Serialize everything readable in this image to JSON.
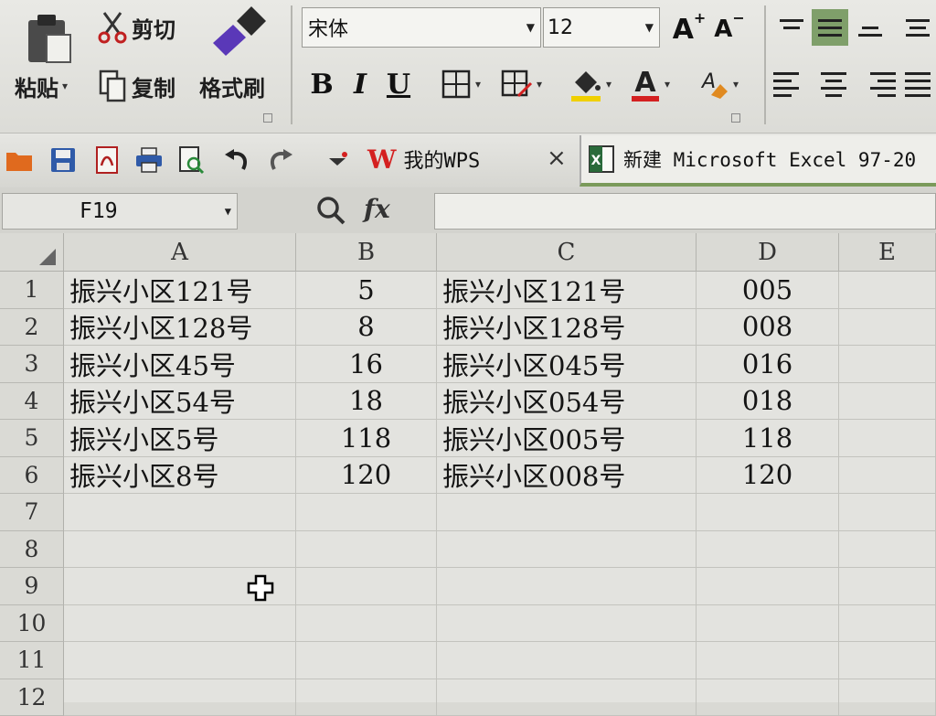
{
  "ribbon": {
    "paste": "粘贴",
    "cut": "剪切",
    "copy": "复制",
    "format_painter": "格式刷",
    "font_name": "宋体",
    "font_size": "12",
    "bold": "B",
    "italic": "I",
    "underline": "U",
    "grow_font": "A",
    "shrink_font": "A"
  },
  "tabs": {
    "wps": "我的WPS",
    "close": "×",
    "excel": "新建 Microsoft Excel 97-20"
  },
  "formula_bar": {
    "name_box": "F19",
    "fx": "fx"
  },
  "grid": {
    "columns": [
      "A",
      "B",
      "C",
      "D",
      "E"
    ],
    "rows": [
      "1",
      "2",
      "3",
      "4",
      "5",
      "6",
      "7",
      "8",
      "9",
      "10",
      "11",
      "12"
    ],
    "cells": [
      [
        "振兴小区121号",
        "5",
        "振兴小区121号",
        "005"
      ],
      [
        "振兴小区128号",
        "8",
        "振兴小区128号",
        "008"
      ],
      [
        "振兴小区45号",
        "16",
        "振兴小区045号",
        "016"
      ],
      [
        "振兴小区54号",
        "18",
        "振兴小区054号",
        "018"
      ],
      [
        "振兴小区5号",
        "118",
        "振兴小区005号",
        "118"
      ],
      [
        "振兴小区8号",
        "120",
        "振兴小区008号",
        "120"
      ]
    ]
  },
  "colors": {
    "font_color_bar": "#d42020",
    "fill_color_bar": "#f0d000",
    "align_active": "#7f9f6a",
    "wps_red": "#d42020"
  }
}
